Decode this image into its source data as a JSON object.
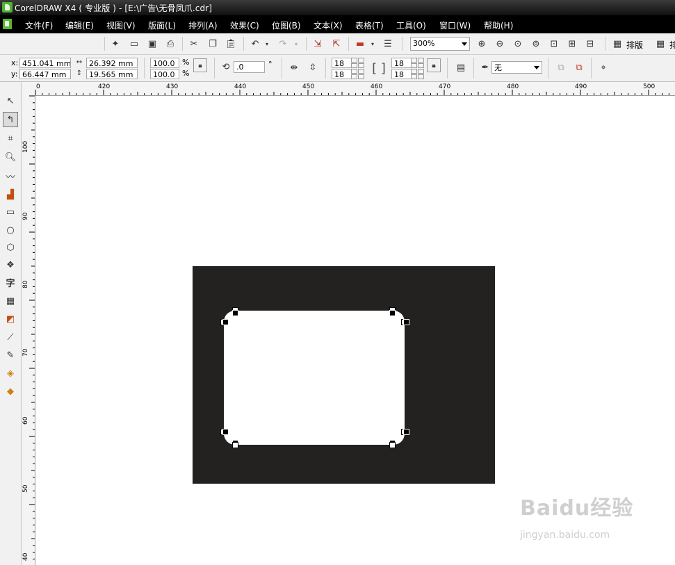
{
  "window": {
    "title": "CorelDRAW X4 ( 专业版 ) - [E:\\广告\\无骨凤爪.cdr]"
  },
  "menu": [
    "文件(F)",
    "编辑(E)",
    "视图(V)",
    "版面(L)",
    "排列(A)",
    "效果(C)",
    "位图(B)",
    "文本(X)",
    "表格(T)",
    "工具(O)",
    "窗口(W)",
    "帮助(H)"
  ],
  "toolbar": {
    "zoom": "300%",
    "layout_label_1": "排版",
    "layout_label_2": "排"
  },
  "property_bar": {
    "x_label": "x:",
    "x_value": "451.041 mm",
    "y_label": "y:",
    "y_value": "66.447 mm",
    "width_value": "26.392 mm",
    "height_value": "19.565 mm",
    "scale_x": "100.0",
    "scale_y": "100.0",
    "percent_1": "%",
    "percent_2": "%",
    "rotation": ".0",
    "degree": "°",
    "corner_tl": "18",
    "corner_bl": "18",
    "corner_tr": "18",
    "corner_br": "18",
    "outline": "无"
  },
  "ruler": {
    "h_labels": [
      "0",
      "420",
      "430",
      "440",
      "450",
      "460",
      "470",
      "480",
      "490",
      "500"
    ],
    "v_labels": [
      "100",
      "90",
      "80",
      "70",
      "60",
      "50",
      "40"
    ]
  },
  "watermark": {
    "main": "Baidu经验",
    "sub": "jingyan.baidu.com"
  }
}
